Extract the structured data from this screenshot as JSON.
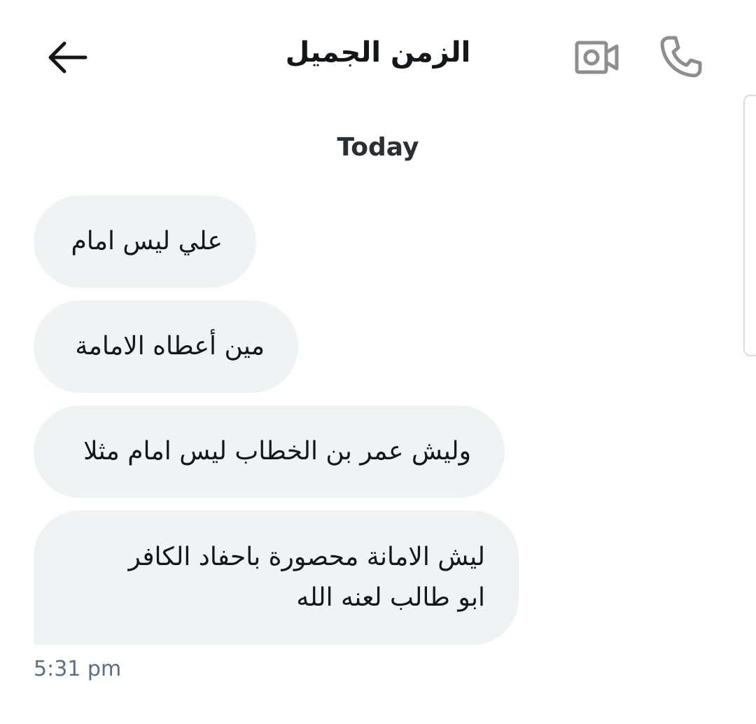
{
  "header": {
    "title": "الزمن الجميل",
    "back_icon": "arrow-left-icon",
    "video_icon": "video-camera-icon",
    "call_icon": "phone-icon"
  },
  "conversation": {
    "day_label": "Today",
    "messages": [
      {
        "text": "علي ليس امام"
      },
      {
        "text": "مين أعطاه الامامة"
      },
      {
        "text": "وليش عمر بن الخطاب ليس امام مثلا"
      },
      {
        "text": "ليش الامانة محصورة باحفاد الكافر\nابو طالب لعنه الله"
      }
    ],
    "timestamp": "5:31 pm"
  },
  "colors": {
    "bubble_bg": "#eff3f4",
    "text": "#14171a",
    "muted": "#5b7083",
    "icon_gray": "#8e8e8e"
  }
}
